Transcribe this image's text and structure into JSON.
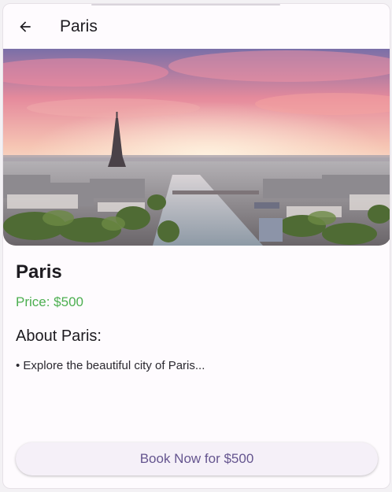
{
  "appbar": {
    "title": "Paris",
    "back_icon": "arrow-back-icon"
  },
  "hero": {
    "image": "paris-eiffel-tower-sunset-photo"
  },
  "destination": {
    "name": "Paris",
    "price_label": "Price: $500"
  },
  "about": {
    "heading": "About Paris:",
    "items": [
      "• Explore the beautiful city of Paris..."
    ]
  },
  "actions": {
    "book_label": "Book Now for $500"
  },
  "colors": {
    "price": "#4caf50",
    "button_text": "#65558f",
    "button_bg": "#f5f0f8",
    "surface": "#fefbfe"
  }
}
